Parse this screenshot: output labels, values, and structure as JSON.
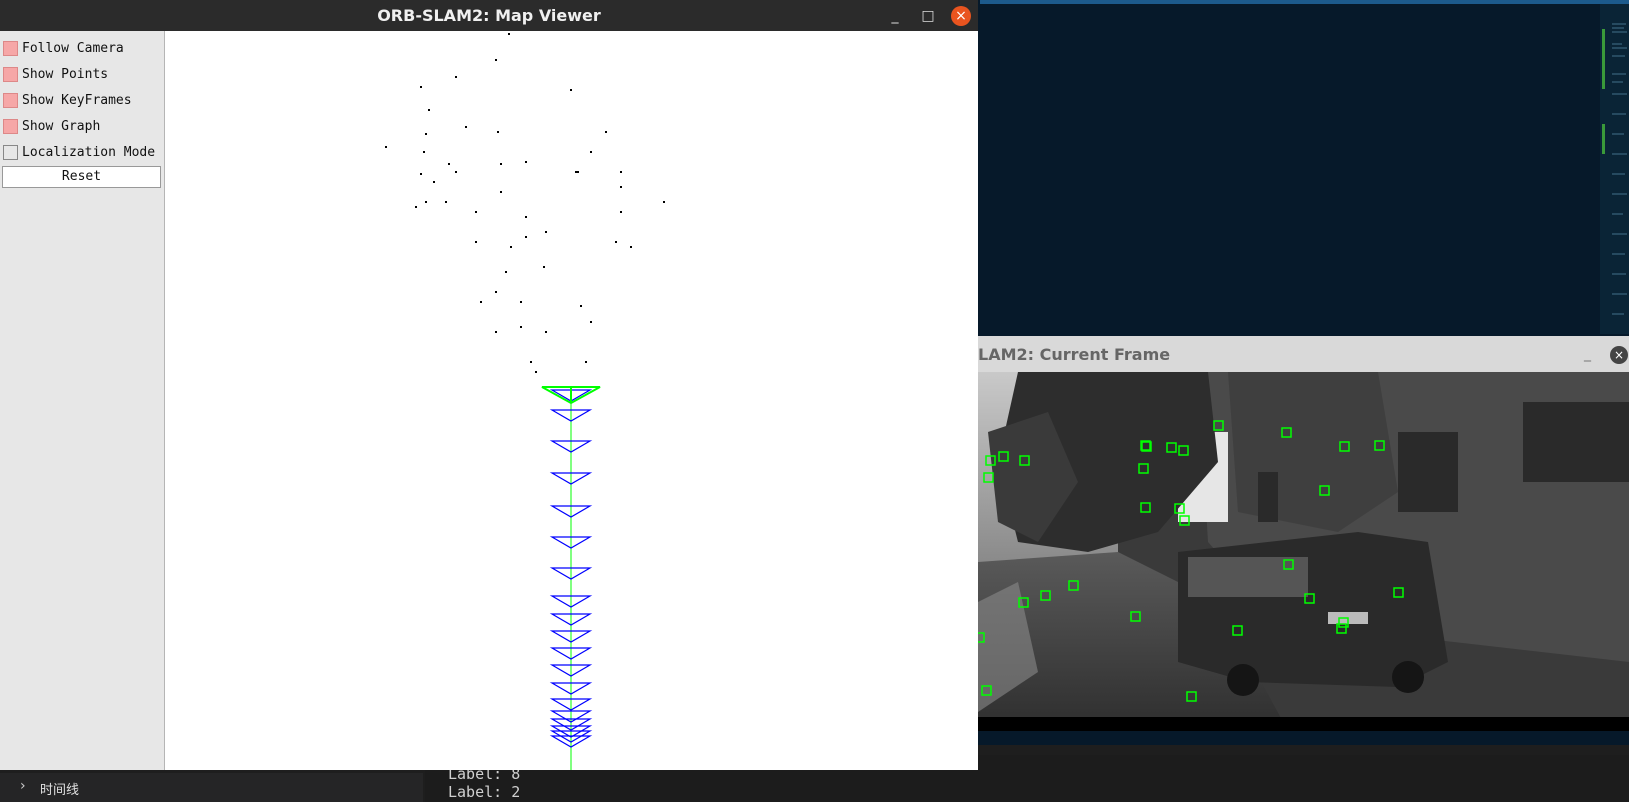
{
  "map_viewer": {
    "title": "ORB-SLAM2: Map Viewer",
    "controls": {
      "minimize": "_",
      "maximize": "□",
      "close": "×"
    },
    "options": [
      {
        "label": "Follow Camera",
        "checked": true
      },
      {
        "label": "Show Points",
        "checked": true
      },
      {
        "label": "Show KeyFrames",
        "checked": true
      },
      {
        "label": "Show Graph",
        "checked": true
      },
      {
        "label": "Localization Mode",
        "checked": false
      }
    ],
    "reset_label": "Reset",
    "colors": {
      "current_camera": "#00ff00",
      "keyframes": "#0000ff",
      "graph": "#00ff00",
      "map_points": "#000000",
      "checked_box": "#f6a7a7"
    }
  },
  "current_frame": {
    "title": "LAM2: Current Frame",
    "minimize": "_",
    "close": "×",
    "feature_color": "#00ff00"
  },
  "terminal": {
    "lines": [
      "Label: 8",
      "Label: 2"
    ]
  },
  "timeline": {
    "chevron": "›",
    "label": "时间线"
  }
}
